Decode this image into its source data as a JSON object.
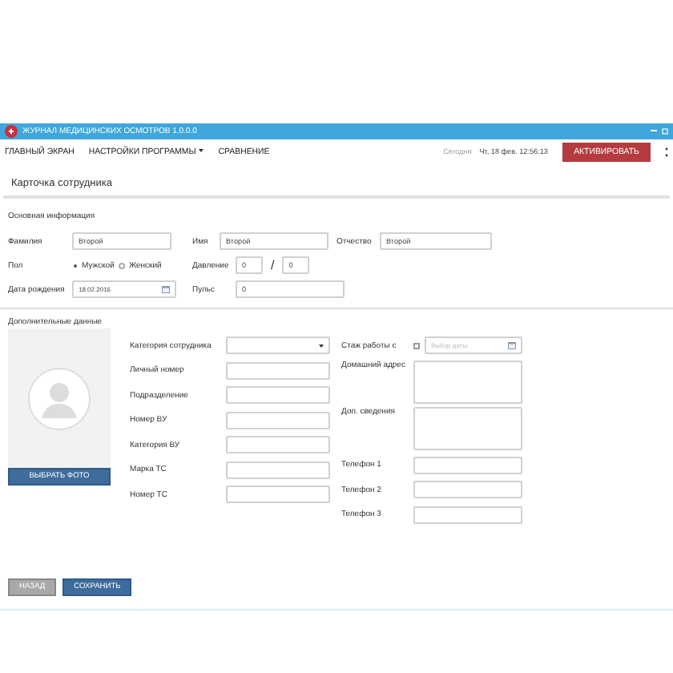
{
  "window": {
    "title": "ЖУРНАЛ МЕДИЦИНСКИХ ОСМОТРОВ 1.0.0.0"
  },
  "menu": {
    "items": [
      {
        "label": "ГЛАВНЫЙ ЭКРАН",
        "dropdown": false
      },
      {
        "label": "НАСТРОЙКИ ПРОГРАММЫ",
        "dropdown": true
      },
      {
        "label": "СРАВНЕНИЕ",
        "dropdown": false
      }
    ],
    "today_label": "Сегодня",
    "datetime": "Чт, 18 фев. 12:56:13",
    "activate_button": "АКТИВИРОВАТЬ"
  },
  "page_title": "Карточка сотрудника",
  "main_info": {
    "heading": "Основная информация",
    "last_name": {
      "label": "Фамилия",
      "value": "Второй"
    },
    "first_name": {
      "label": "Имя",
      "value": "Второй"
    },
    "patronymic": {
      "label": "Отчество",
      "value": "Второй"
    },
    "gender": {
      "label": "Пол",
      "options": [
        {
          "label": "Мужской",
          "selected": true
        },
        {
          "label": "Женский",
          "selected": false
        }
      ]
    },
    "pressure": {
      "label": "Давление",
      "systolic": "0",
      "separator": "/",
      "diastolic": "0"
    },
    "birth_date": {
      "label": "Дата рождения",
      "value": "18.02.2016"
    },
    "pulse": {
      "label": "Пульс",
      "value": "0"
    }
  },
  "extra": {
    "heading": "Дополнительные данные",
    "photo_button": "ВЫБРАТЬ ФОТО",
    "left_fields": [
      {
        "label": "Категория сотрудника",
        "kind": "select"
      },
      {
        "label": "Личный номер",
        "kind": "text"
      },
      {
        "label": "Подразделение",
        "kind": "text"
      },
      {
        "label": "Номер ВУ",
        "kind": "text"
      },
      {
        "label": "Категория ВУ",
        "kind": "text"
      },
      {
        "label": "Марка ТС",
        "kind": "text"
      },
      {
        "label": "Номер ТС",
        "kind": "text"
      }
    ],
    "right_fields": [
      {
        "label": "Стаж работы с",
        "kind": "date",
        "checked": false,
        "placeholder": "Выбор даты"
      },
      {
        "label": "Домашний адрес",
        "kind": "area"
      },
      {
        "label": "Доп. сведения",
        "kind": "area"
      },
      {
        "label": "Телефон 1",
        "kind": "text"
      },
      {
        "label": "Телефон 2",
        "kind": "text"
      },
      {
        "label": "Телефон 3",
        "kind": "text"
      }
    ]
  },
  "buttons": [
    {
      "label": "НАЗАД",
      "kind": "secondary"
    },
    {
      "label": "СОХРАНИТЬ",
      "kind": "primary"
    }
  ]
}
